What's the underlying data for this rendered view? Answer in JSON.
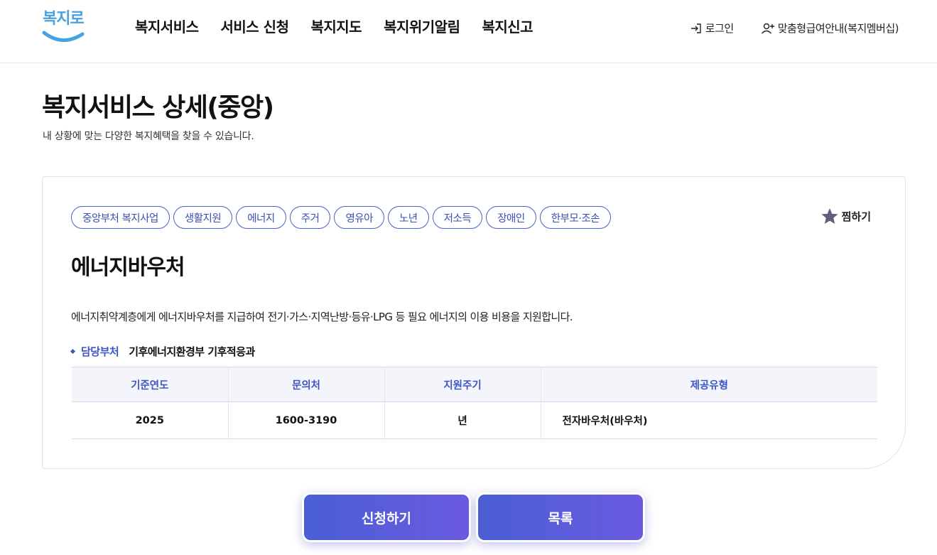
{
  "logo": {
    "text": "복지로"
  },
  "nav": {
    "items": [
      "복지서비스",
      "서비스 신청",
      "복지지도",
      "복지위기알림",
      "복지신고"
    ]
  },
  "util": {
    "login": "로그인",
    "membership": "맞춤형급여안내(복지멤버십)"
  },
  "page": {
    "title": "복지서비스 상세(중앙)",
    "description": "내 상황에 맞는 다양한 복지혜택을 찾을 수 있습니다."
  },
  "service": {
    "tags": [
      "중앙부처 복지사업",
      "생활지원",
      "에너지",
      "주거",
      "영유아",
      "노년",
      "저소득",
      "장애인",
      "한부모·조손"
    ],
    "bookmark_label": "찜하기",
    "title": "에너지바우처",
    "description": "에너지취약계층에게 에너지바우처를 지급하여 전기·가스·지역난방·등유·LPG 등 필요 에너지의 이용 비용을 지원합니다.",
    "dept_label": "담당부처",
    "dept_value": "기후에너지환경부 기후적응과",
    "table": {
      "headers": [
        "기준연도",
        "문의처",
        "지원주기",
        "제공유형"
      ],
      "row": [
        "2025",
        "1600-3190",
        "년",
        "전자바우처(바우처)"
      ]
    }
  },
  "actions": {
    "apply": "신청하기",
    "list": "목록"
  },
  "colors": {
    "accent": "#3e56c4",
    "button_gradient_start": "#4a5fd3",
    "button_gradient_end": "#6a5ae0",
    "logo": "#47a3e0"
  }
}
